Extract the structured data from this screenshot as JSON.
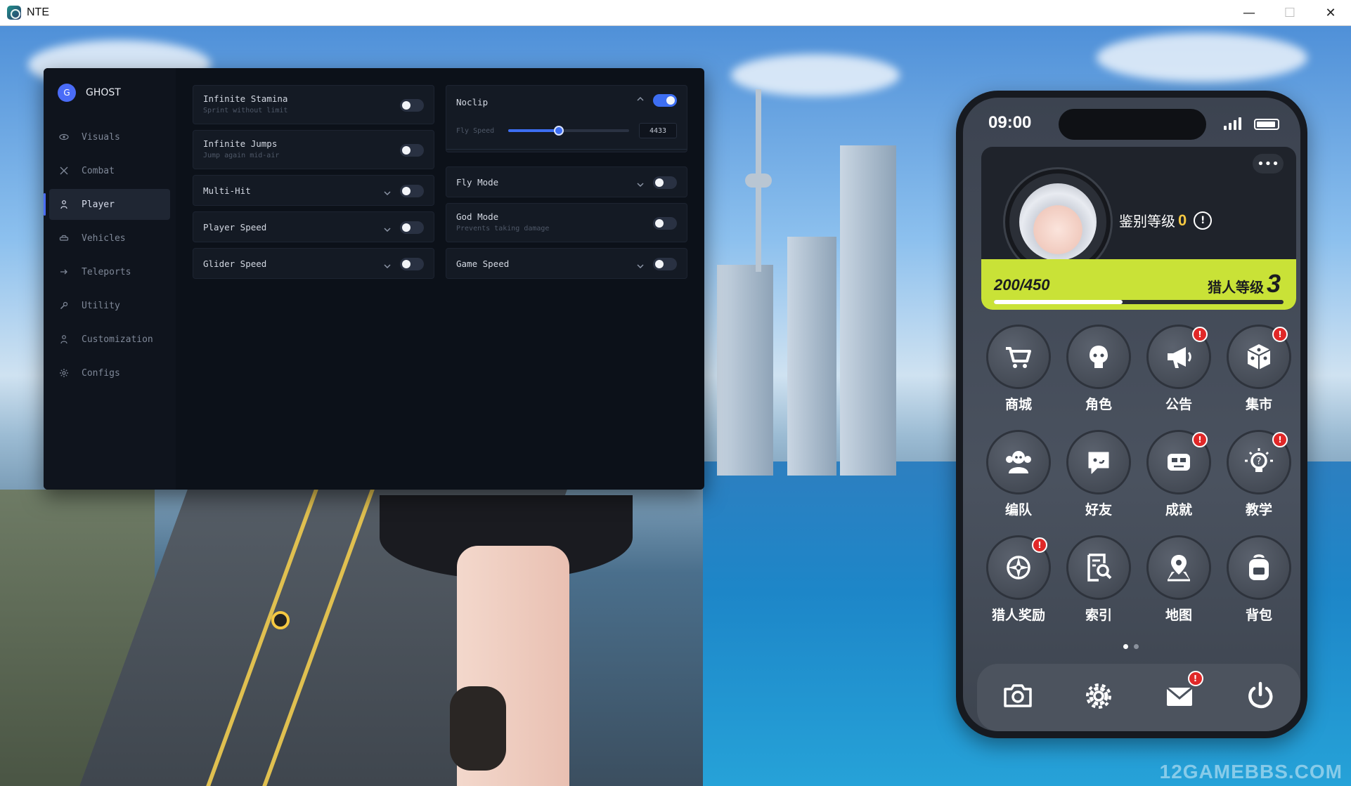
{
  "window": {
    "title": "NTE",
    "minimize": "—",
    "maximize": "☐",
    "close": "✕"
  },
  "menu": {
    "brand_logo": "G",
    "brand_name": "GHOST",
    "nav": [
      {
        "label": "Visuals",
        "icon": "eye-icon",
        "active": false
      },
      {
        "label": "Combat",
        "icon": "crossed-swords-icon",
        "active": false
      },
      {
        "label": "Player",
        "icon": "person-icon",
        "active": true
      },
      {
        "label": "Vehicles",
        "icon": "car-icon",
        "active": false
      },
      {
        "label": "Teleports",
        "icon": "arrow-right-icon",
        "active": false
      },
      {
        "label": "Utility",
        "icon": "wrench-icon",
        "active": false
      },
      {
        "label": "Customization",
        "icon": "person-icon",
        "active": false
      },
      {
        "label": "Configs",
        "icon": "gear-icon",
        "active": false
      }
    ],
    "left_col": [
      {
        "label": "Infinite Stamina",
        "sub": "Sprint without limit",
        "enabled": false
      },
      {
        "label": "Infinite Jumps",
        "sub": "Jump again mid-air",
        "enabled": false
      },
      {
        "label": "Multi-Hit",
        "expandable": true,
        "enabled": false
      },
      {
        "label": "Player Speed",
        "expandable": true,
        "enabled": false
      },
      {
        "label": "Glider Speed",
        "expandable": true,
        "enabled": false
      }
    ],
    "noclip": {
      "label": "Noclip",
      "enabled": true,
      "slider_label": "Fly Speed",
      "slider_value": "4433",
      "slider_fraction": 0.42
    },
    "right_col": [
      {
        "label": "Fly Mode",
        "expandable": true,
        "enabled": false
      },
      {
        "label": "God Mode",
        "sub": "Prevents taking damage",
        "enabled": false
      },
      {
        "label": "Game Speed",
        "expandable": true,
        "enabled": false
      }
    ]
  },
  "phone": {
    "time": "09:00",
    "more": "•••",
    "id_rank_label": "鉴别等级",
    "id_rank_value": "0",
    "exp_text": "200/450",
    "exp_fraction": 0.444,
    "hunter_level_label": "猎人等级",
    "hunter_level_value": "3",
    "apps": [
      {
        "label": "商城",
        "icon": "shopping-cart-icon",
        "badge": false
      },
      {
        "label": "角色",
        "icon": "character-icon",
        "badge": false
      },
      {
        "label": "公告",
        "icon": "megaphone-icon",
        "badge": true
      },
      {
        "label": "集市",
        "icon": "dice-icon",
        "badge": true
      },
      {
        "label": "编队",
        "icon": "team-icon",
        "badge": false
      },
      {
        "label": "好友",
        "icon": "chat-bubble-icon",
        "badge": false
      },
      {
        "label": "成就",
        "icon": "achievement-icon",
        "badge": true
      },
      {
        "label": "教学",
        "icon": "lightbulb-icon",
        "badge": true
      },
      {
        "label": "猎人奖励",
        "icon": "compass-icon",
        "badge": true
      },
      {
        "label": "索引",
        "icon": "search-document-icon",
        "badge": false
      },
      {
        "label": "地图",
        "icon": "map-pin-icon",
        "badge": false
      },
      {
        "label": "背包",
        "icon": "backpack-icon",
        "badge": false
      }
    ],
    "badge_mark": "!",
    "dock": [
      {
        "icon": "camera-icon",
        "badge": false
      },
      {
        "icon": "gear-icon",
        "badge": false
      },
      {
        "icon": "mail-icon",
        "badge": true
      },
      {
        "icon": "power-icon",
        "badge": false
      }
    ]
  },
  "watermark": "12GAMEBBS.COM"
}
